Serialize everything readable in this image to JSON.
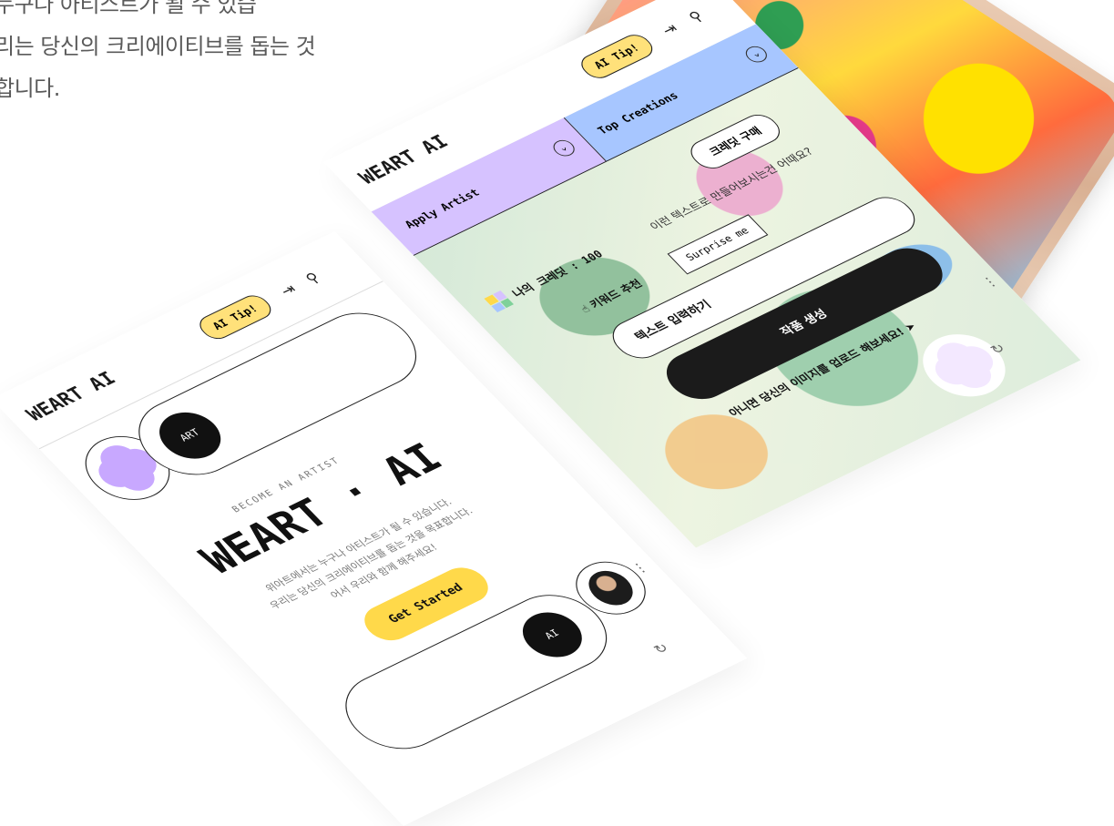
{
  "intro": {
    "lines": [
      "누구나 아티스트가 될 수 있습",
      "리는 당신의 크리에이티브를 돕는 것",
      "합니다."
    ]
  },
  "screen_a": {
    "logo": "WEART AI",
    "tip": "AI Tip!",
    "art_badge": "ART",
    "become": "BECOME AN ARTIST",
    "title": "WEART · AI",
    "desc": [
      "위아트에서는 누구나 아티스트가 될 수 있습니다.",
      "우리는 당신의 크리에이티브를 돕는 것을 목표합니다.",
      "어서 우리와 함께 해주세요!"
    ],
    "cta": "Get Started",
    "ai_badge": "AI"
  },
  "screen_b": {
    "logo": "WEART AI",
    "tip": "AI Tip!",
    "tab_apply": "Apply Artist",
    "tab_top": "Top Creations",
    "buy_credit": "크레딧 구매",
    "credit": "나의 크레딧 : 100",
    "question": "이런 텍스트로 만들어보시는건 어때요?",
    "keyword": "키워드 추천",
    "surprise": "Surprise me",
    "input_label": "텍스트 입력하기",
    "generate": "작품 생성",
    "upload": "아니면 당신의 이미지를 업로드 해보세요!"
  },
  "colors": {
    "yellow": "#ffd94a",
    "purple": "#d6c2ff",
    "blue": "#a7c6ff"
  }
}
